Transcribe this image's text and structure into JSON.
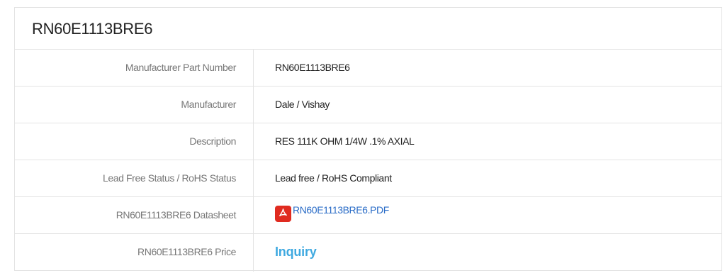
{
  "title": "RN60E1113BRE6",
  "rows": [
    {
      "label": "Manufacturer Part Number",
      "value": "RN60E1113BRE6"
    },
    {
      "label": "Manufacturer",
      "value": "Dale / Vishay"
    },
    {
      "label": "Description",
      "value": "RES 111K OHM 1/4W .1% AXIAL"
    },
    {
      "label": "Lead Free Status / RoHS Status",
      "value": "Lead free / RoHS Compliant"
    },
    {
      "label": "RN60E1113BRE6 Datasheet",
      "value": "RN60E1113BRE6.PDF",
      "icon": "pdf-icon"
    },
    {
      "label": "RN60E1113BRE6 Price",
      "value": "Inquiry"
    }
  ],
  "colors": {
    "link": "#2a6cc7",
    "inquiry": "#3fa9e0",
    "pdf_icon": "#e02b20"
  }
}
